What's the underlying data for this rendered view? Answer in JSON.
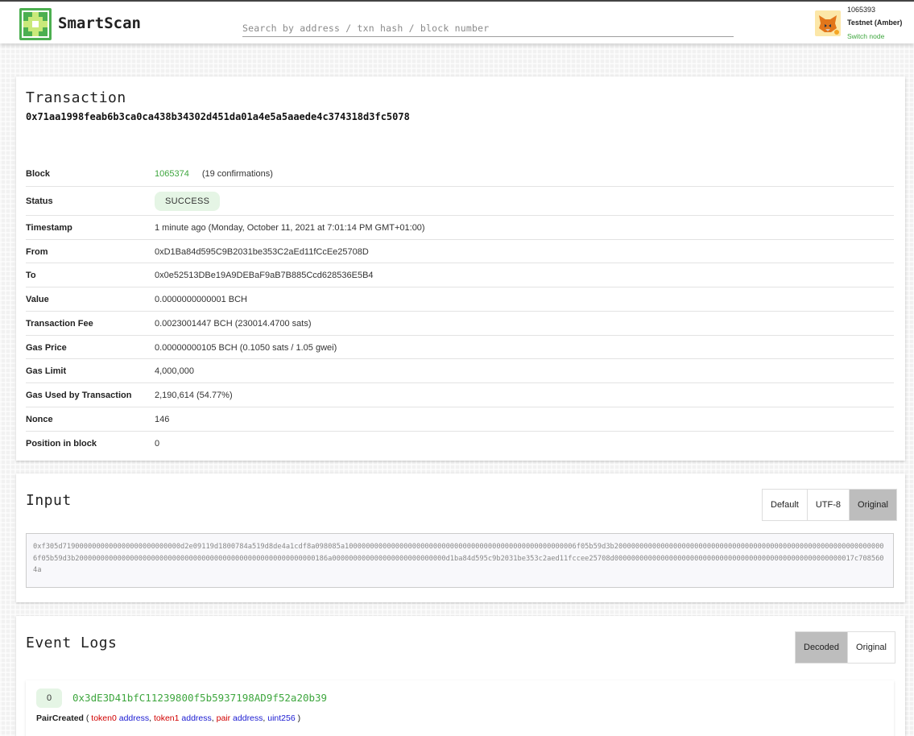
{
  "header": {
    "brand": "SmartScan",
    "search_placeholder": "Search by address / txn hash / block number",
    "node_block": "1065393",
    "node_network": "Testnet (Amber)",
    "switch_node": "Switch node"
  },
  "transaction": {
    "title": "Transaction",
    "hash": "0x71aa1998feab6b3ca0ca438b34302d451da01a4e5a5aaede4c374318d3fc5078",
    "block": {
      "label": "Block",
      "value": "1065374",
      "confirmations": "(19 confirmations)"
    },
    "status": {
      "label": "Status",
      "value": "SUCCESS"
    },
    "timestamp": {
      "label": "Timestamp",
      "value": "1 minute ago  (Monday, October 11, 2021 at 7:01:14 PM GMT+01:00)"
    },
    "from": {
      "label": "From",
      "value": "0xD1Ba84d595C9B2031be353C2aEd11fCcEe25708D"
    },
    "to": {
      "label": "To",
      "value": "0x0e52513DBe19A9DEBaF9aB7B885Ccd628536E5B4"
    },
    "value": {
      "label": "Value",
      "value": "0.0000000000001 BCH"
    },
    "fee": {
      "label": "Transaction Fee",
      "value": "0.0023001447 BCH (230014.4700 sats)"
    },
    "gas_price": {
      "label": "Gas Price",
      "value": "0.00000000105 BCH (0.1050 sats / 1.05 gwei)"
    },
    "gas_limit": {
      "label": "Gas Limit",
      "value": "4,000,000"
    },
    "gas_used": {
      "label": "Gas Used by Transaction",
      "value": "2,190,614 (54.77%)"
    },
    "nonce": {
      "label": "Nonce",
      "value": "146"
    },
    "position": {
      "label": "Position in block",
      "value": "0"
    }
  },
  "input": {
    "title": "Input",
    "modes": [
      "Default",
      "UTF-8",
      "Original"
    ],
    "active_mode": "Original",
    "data": "0xf305d7190000000000000000000000000d2e09119d1800784a519d8de4a1cdf8a098085a1000000000000000000000000000000000000000000000000000006f05b59d3b20000000000000000000000000000000000000000000000000000000000000006f05b59d3b200000000000000000000000000000000000000000000000000000000186a000000000000000000000000000d1ba84d595c9b2031be353c2aed11fccee25708d000000000000000000000000000000000000000000000000000000017c7085604a"
  },
  "event_logs": {
    "title": "Event Logs",
    "modes": [
      "Decoded",
      "Original"
    ],
    "active_mode": "Decoded",
    "logs": [
      {
        "index": "0",
        "address": "0x3dE3D41bfC11239800f5b5937198AD9f52a20b39",
        "event": "PairCreated",
        "params": [
          {
            "name": "token0",
            "type": "address"
          },
          {
            "name": "token1",
            "type": "address"
          },
          {
            "name": "pair",
            "type": "address"
          },
          {
            "name": "",
            "type": "uint256"
          }
        ]
      }
    ]
  },
  "colors": {
    "accent": "#3ea63e",
    "badge_bg": "#e5f5e5",
    "param_name": "#d10000",
    "param_type": "#1a1ad1"
  }
}
